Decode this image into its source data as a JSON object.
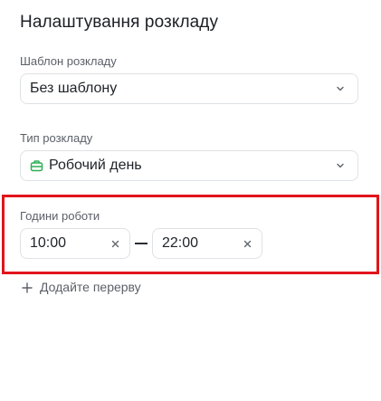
{
  "title": "Налаштування розкладу",
  "template": {
    "label": "Шаблон розкладу",
    "value": "Без шаблону"
  },
  "schedule_type": {
    "label": "Тип розкладу",
    "value": "Робочий день",
    "icon": "briefcase-icon",
    "icon_color": "#2fae55"
  },
  "working_hours": {
    "label": "Години роботи",
    "start": "10:00",
    "end": "22:00",
    "highlight_color": "#e1141b"
  },
  "add_break": {
    "label": "Додайте перерву"
  }
}
